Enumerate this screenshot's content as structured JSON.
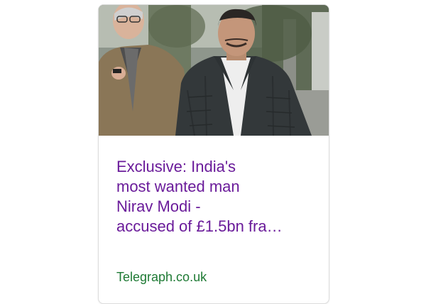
{
  "card": {
    "headline_lines": [
      "Exclusive: India's",
      "most wanted man",
      "Nirav Modi -",
      "accused of £1.5bn fra…"
    ],
    "source": "Telegraph.co.uk",
    "colors": {
      "headline": "#6a1b9a",
      "source": "#1e7a34",
      "border": "#dcdcdc"
    }
  }
}
